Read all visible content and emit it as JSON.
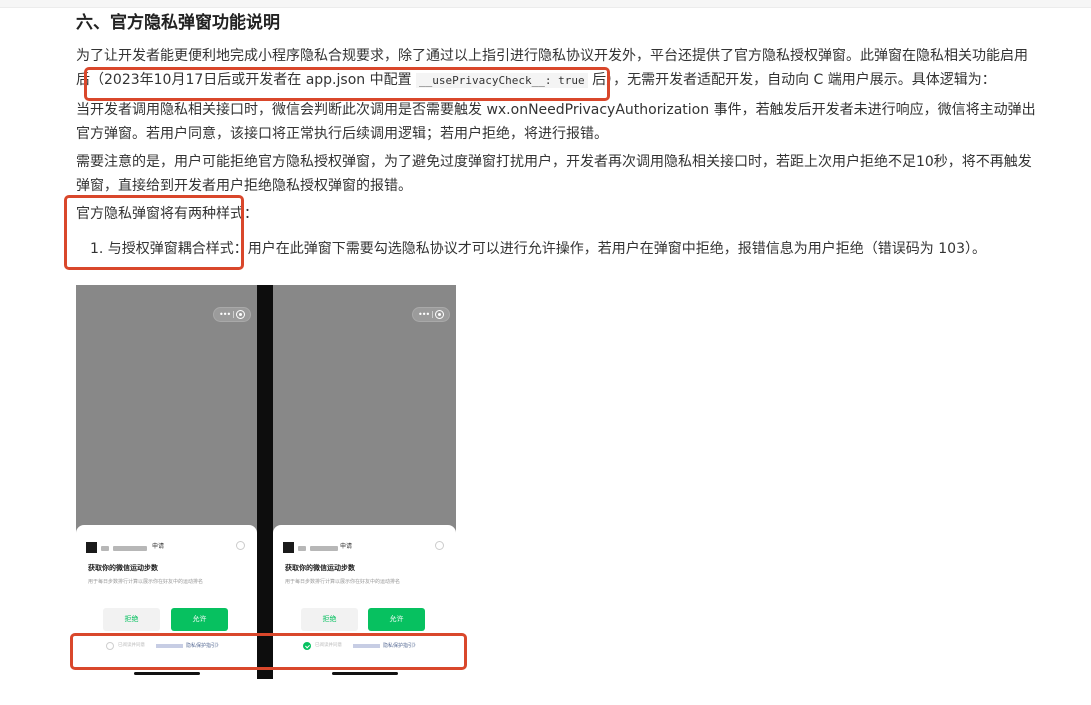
{
  "section": {
    "title": "六、官方隐私弹窗功能说明"
  },
  "paragraphs": {
    "p1_a": "为了让开发者能更便利地完成小程序隐私合规要求，除了通过以上指引进行隐私协议开发外，平台还提供了官方隐私授权弹窗。此弹窗在隐私相关功能启用后（2023年10月17日后或开发者在 app.json 中配置 ",
    "p1_code": "__usePrivacyCheck__: true",
    "p1_b": " 后），无需开发者适配开发，自动向 C 端用户展示。具体逻辑为：",
    "p2": "当开发者调用隐私相关接口时，微信会判断此次调用是否需要触发 wx.onNeedPrivacyAuthorization 事件，若触发后开发者未进行响应，微信将主动弹出官方弹窗。若用户同意，该接口将正常执行后续调用逻辑；若用户拒绝，将进行报错。",
    "p3": "需要注意的是，用户可能拒绝官方隐私授权弹窗，为了避免过度弹窗打扰用户，开发者再次调用隐私相关接口时，若距上次用户拒绝不足10秒，将不再触发弹窗，直接给到开发者用户拒绝隐私授权弹窗的报错。",
    "p4": "官方隐私弹窗将有两种样式：",
    "li1": "1. 与授权弹窗耦合样式：用户在此弹窗下需要勾选隐私协议才可以进行允许操作，若用户在弹窗中拒绝，报错信息为用户拒绝（错误码为 103）。"
  },
  "phones": [
    {
      "request": "申请",
      "title": "获取你的微信运动步数",
      "desc": "用于每日步数排行计算以展示你在好友中的运动排名",
      "reject": "拒绝",
      "allow": "允许",
      "agree_prefix": "已阅读并同意",
      "agree_link": "隐私保护指引》",
      "checked": false
    },
    {
      "request": "申请",
      "title": "获取你的微信运动步数",
      "desc": "用于每日步数排行计算以展示你在好友中的运动排名",
      "reject": "拒绝",
      "allow": "允许",
      "agree_prefix": "已阅读并同意",
      "agree_link": "隐私保护指引》",
      "checked": true
    }
  ],
  "colors": {
    "accent_green": "#07c160",
    "highlight_red": "#d9472b",
    "link_blue": "#576b95"
  }
}
